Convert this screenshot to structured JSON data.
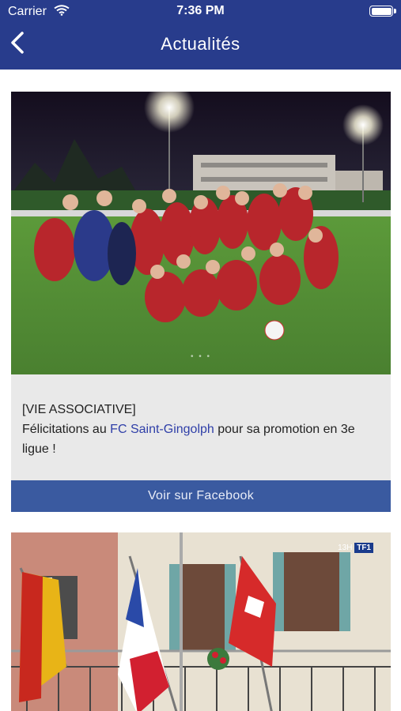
{
  "status_bar": {
    "carrier": "Carrier",
    "time": "7:36 PM"
  },
  "header": {
    "title": "Actualités"
  },
  "posts": [
    {
      "photo_icon": "team-photo",
      "text_prefix": "[VIE ASSOCIATIVE]",
      "text_before_link": "Félicitations au ",
      "link_text": "FC Saint-Gingolph",
      "text_after_link": " pour sa promotion en 3e ligue !",
      "button_label": "Voir sur Facebook"
    },
    {
      "photo_icon": "flags-photo",
      "tv_badge_time": "13H",
      "tv_badge_channel": "TF1"
    }
  ],
  "colors": {
    "header": "#283c8c",
    "button": "#3a5aa0",
    "link": "#2f3fa8"
  }
}
